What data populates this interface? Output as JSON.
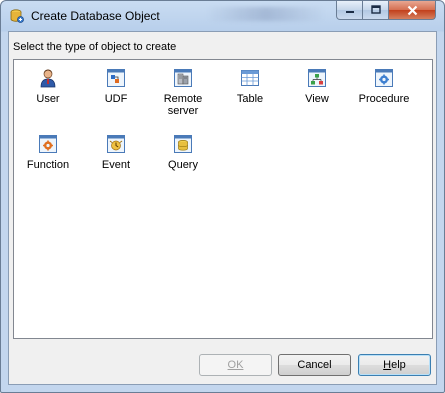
{
  "window": {
    "title": "Create Database Object",
    "app_icon": "database-icon"
  },
  "title_controls": {
    "minimize": "minimize-icon",
    "maximize": "maximize-icon",
    "close": "close-icon"
  },
  "prompt": "Select the type of object to create",
  "objects": [
    {
      "label": "User",
      "icon": "user-icon"
    },
    {
      "label": "UDF",
      "icon": "udf-icon"
    },
    {
      "label": "Remote server",
      "icon": "remote-server-icon"
    },
    {
      "label": "Table",
      "icon": "table-icon"
    },
    {
      "label": "View",
      "icon": "view-icon"
    },
    {
      "label": "Procedure",
      "icon": "procedure-icon"
    },
    {
      "label": "Function",
      "icon": "function-icon"
    },
    {
      "label": "Event",
      "icon": "event-icon"
    },
    {
      "label": "Query",
      "icon": "query-icon"
    }
  ],
  "buttons": {
    "ok": {
      "label": "OK",
      "enabled": false
    },
    "cancel": {
      "label": "Cancel"
    },
    "help": {
      "label_underlined": "H",
      "label_rest": "elp"
    }
  }
}
